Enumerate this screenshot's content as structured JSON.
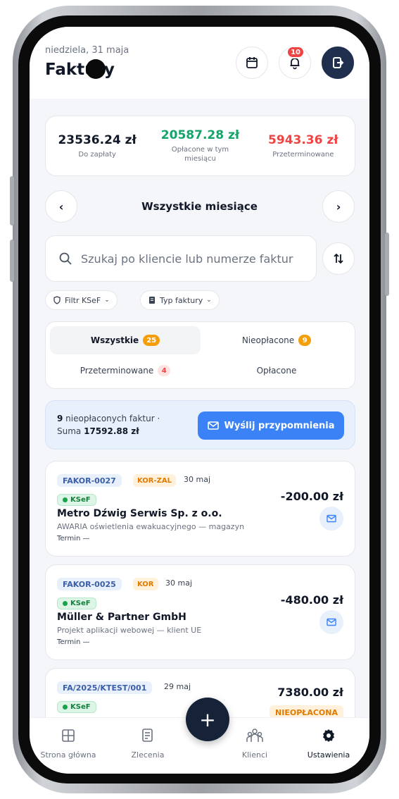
{
  "header": {
    "date": "niedziela, 31 maja",
    "title": "Faktury",
    "notification_count": "10"
  },
  "summary": [
    {
      "value": "23536.24 zł",
      "label": "Do zapłaty",
      "color": "#111827"
    },
    {
      "value": "20587.28 zł",
      "label": "Opłacone w tym miesiącu",
      "color": "#16a36a"
    },
    {
      "value": "5943.36 zł",
      "label": "Przeterminowane",
      "color": "#ef4444"
    }
  ],
  "month_nav": {
    "label": "Wszystkie miesiące",
    "prev": "‹",
    "next": "›"
  },
  "search": {
    "placeholder": "Szukaj po kliencie lub numerze faktur"
  },
  "filters": {
    "ksef": "Filtr KSeF",
    "type": "Typ faktury"
  },
  "tabs": {
    "all": {
      "label": "Wszystkie",
      "count": "25"
    },
    "unpaid": {
      "label": "Nieopłacone",
      "count": "9"
    },
    "overdue": {
      "label": "Przeterminowane",
      "count": "4"
    },
    "paid": {
      "label": "Opłacone"
    }
  },
  "banner": {
    "count": "9",
    "text": " nieopłaconych faktur ·",
    "sum_label": "Suma ",
    "sum_value": "17592.88 zł",
    "button": "Wyślij przypomnienia"
  },
  "invoices": [
    {
      "number": "FAKOR-0027",
      "type": "KOR-ZAL",
      "date": "30 maj",
      "ksef": "KSeF",
      "client": "Metro Dźwig Serwis Sp. z o.o.",
      "description": "AWARIA oświetlenia ewakuacyjnego — magazyn",
      "term": "Termin —",
      "amount": "-200.00 zł"
    },
    {
      "number": "FAKOR-0025",
      "type": "KOR",
      "date": "30 maj",
      "ksef": "KSeF",
      "client": "Müller & Partner GmbH",
      "description": "Projekt aplikacji webowej — klient UE",
      "term": "Termin —",
      "amount": "-480.00 zł"
    },
    {
      "number": "FA/2025/KTEST/001",
      "date": "29 maj",
      "ksef": "KSeF",
      "amount": "7380.00 zł",
      "status": "NIEOPŁACONA"
    }
  ],
  "bottom_nav": {
    "home": "Strona główna",
    "orders": "Zlecenia",
    "clients": "Klienci",
    "settings": "Ustawienia"
  },
  "icons": [
    "calendar-icon",
    "bell-icon",
    "logout-icon",
    "search-icon",
    "sort-icon",
    "shield-icon",
    "document-icon",
    "mail-icon",
    "grid-icon",
    "clients-icon",
    "gear-icon",
    "plus-icon"
  ]
}
